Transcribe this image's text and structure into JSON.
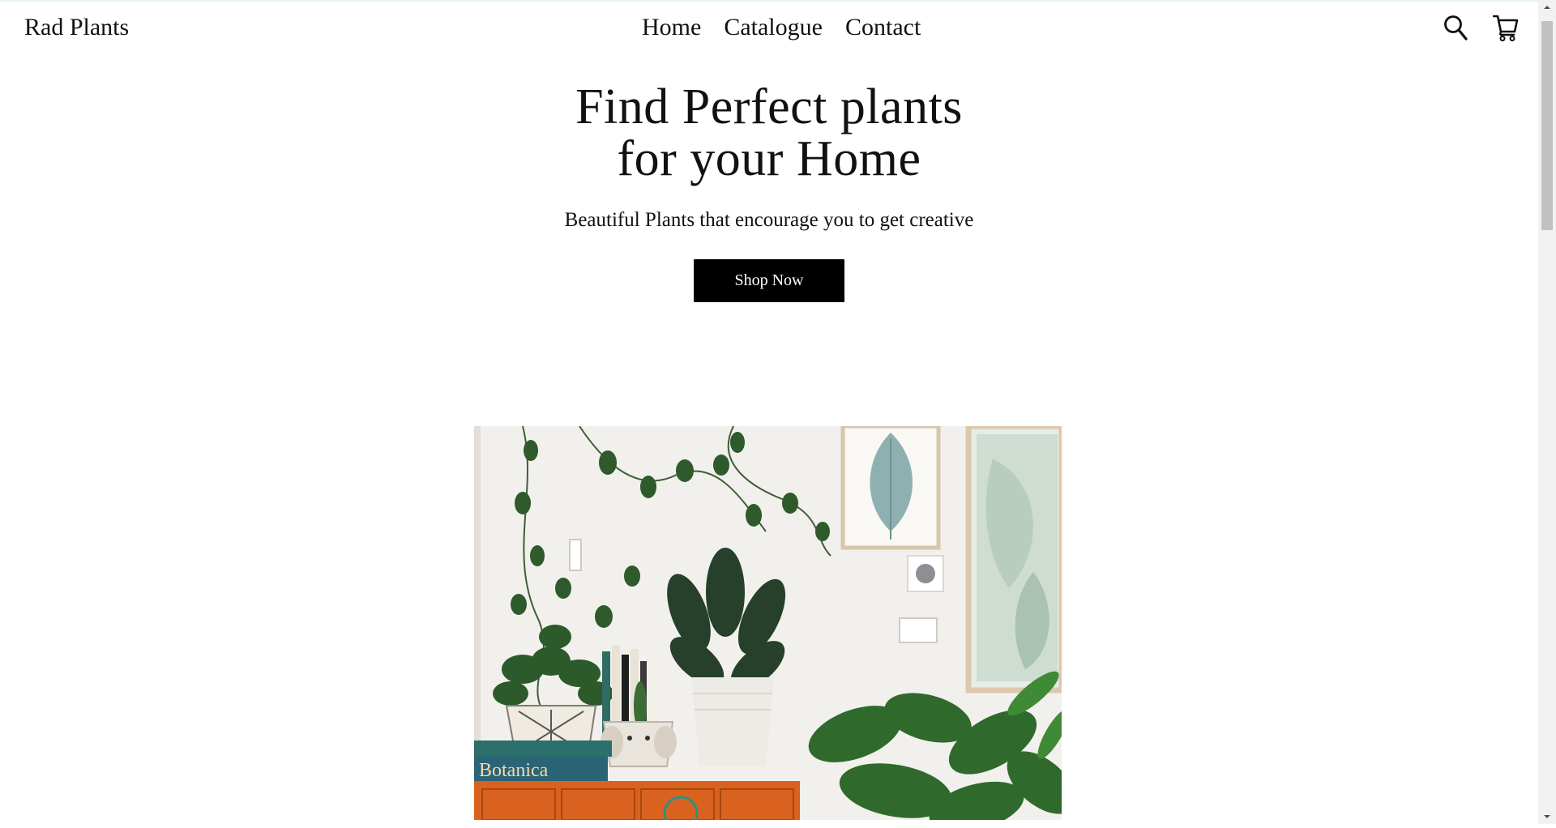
{
  "header": {
    "brand": "Rad Plants",
    "nav": [
      "Home",
      "Catalogue",
      "Contact"
    ],
    "icons": [
      "search-icon",
      "cart-icon"
    ]
  },
  "hero": {
    "title_line1": "Find Perfect plants",
    "title_line2": "for your Home",
    "subtitle": "Beautiful Plants that encourage you to get creative",
    "cta": "Shop Now"
  },
  "photo": {
    "book_title": "Botanica"
  },
  "colors": {
    "button_bg": "#000000",
    "button_text": "#ffffff",
    "background": "#ffffff",
    "text": "#111111",
    "drawer_wood": "#d9621f",
    "leaf_green": "#2f5a2c"
  }
}
